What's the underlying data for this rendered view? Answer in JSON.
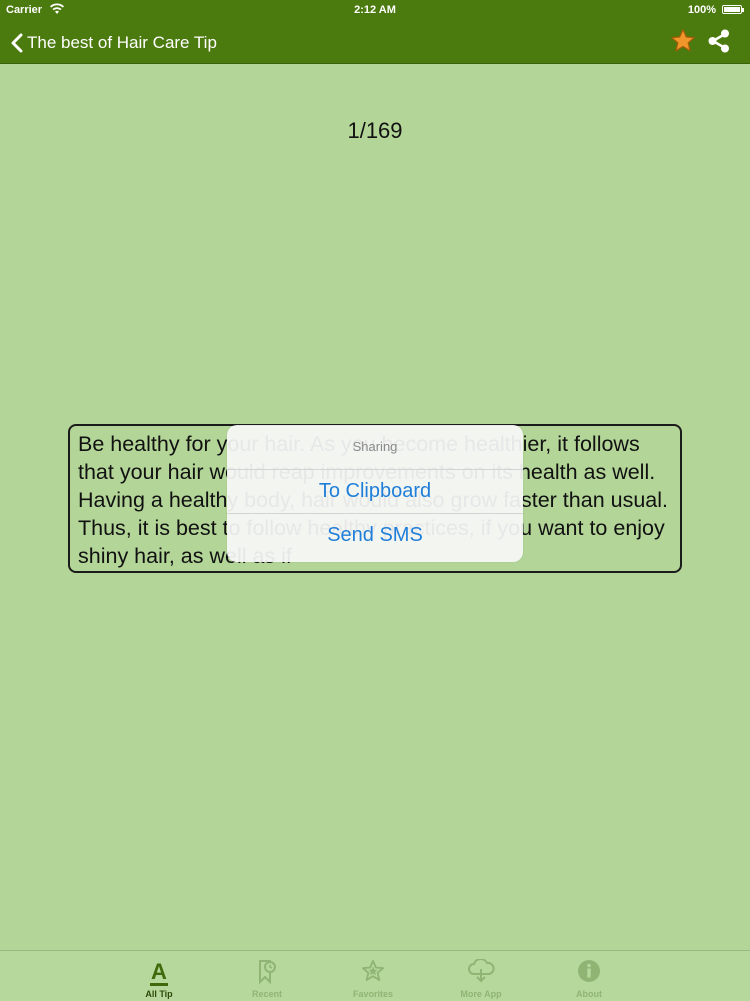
{
  "status": {
    "carrier": "Carrier",
    "time": "2:12 AM",
    "battery": "100%"
  },
  "nav": {
    "back_label": "The best of Hair Care Tip",
    "icons": [
      "star-icon",
      "share-icon"
    ]
  },
  "tip": {
    "counter": "1/169",
    "text": "Be healthy for your hair. As you become healthier, it follows that your hair would reap improvements on its health as well. Having a healthy body, hair would also grow faster than usual. Thus, it is best to follow healthy practices, if you want to enjoy shiny hair, as well as if"
  },
  "sheet": {
    "title": "Sharing",
    "buttons": [
      "To Clipboard",
      "Send SMS"
    ]
  },
  "tabs": [
    {
      "label": "All Tip",
      "icon": "letter-a-icon",
      "active": true
    },
    {
      "label": "Recent",
      "icon": "recent-bookmark-icon",
      "active": false
    },
    {
      "label": "Favorites",
      "icon": "star-icon",
      "active": false
    },
    {
      "label": "More App",
      "icon": "cloud-download-icon",
      "active": false
    },
    {
      "label": "About",
      "icon": "info-icon",
      "active": false
    }
  ],
  "colors": {
    "nav_bg": "#4b7a0e",
    "page_bg": "#b3d598",
    "accent_blue": "#1f7ed9",
    "star_orange": "#f0962b"
  }
}
